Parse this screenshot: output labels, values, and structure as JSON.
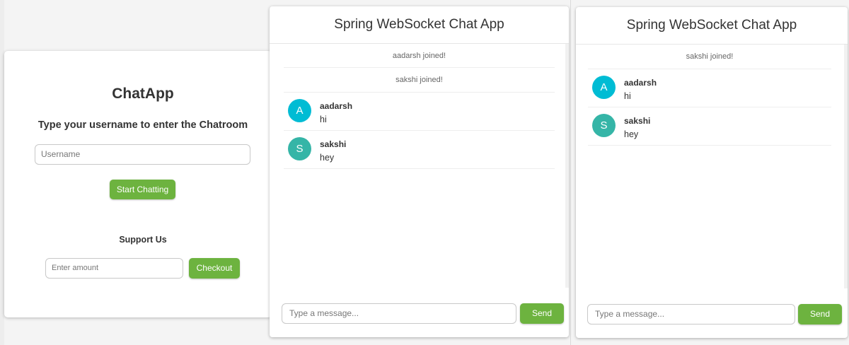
{
  "colors": {
    "accent": "#6db33f",
    "avatar_a": "#00bcd4",
    "avatar_s": "#35b5a7"
  },
  "login": {
    "title": "ChatApp",
    "subtitle": "Type your username to enter the Chatroom",
    "username_placeholder": "Username",
    "start_label": "Start Chatting",
    "support_title": "Support Us",
    "amount_placeholder": "Enter amount",
    "checkout_label": "Checkout"
  },
  "chat1": {
    "title": "Spring WebSocket Chat App",
    "events": [
      "aadarsh joined!",
      "sakshi joined!"
    ],
    "messages": [
      {
        "avatar": "A",
        "user": "aadarsh",
        "text": "hi"
      },
      {
        "avatar": "S",
        "user": "sakshi",
        "text": "hey"
      }
    ],
    "input_placeholder": "Type a message...",
    "send_label": "Send"
  },
  "chat2": {
    "title": "Spring WebSocket Chat App",
    "events": [
      "sakshi joined!"
    ],
    "messages": [
      {
        "avatar": "A",
        "user": "aadarsh",
        "text": "hi"
      },
      {
        "avatar": "S",
        "user": "sakshi",
        "text": "hey"
      }
    ],
    "input_placeholder": "Type a message...",
    "send_label": "Send"
  }
}
